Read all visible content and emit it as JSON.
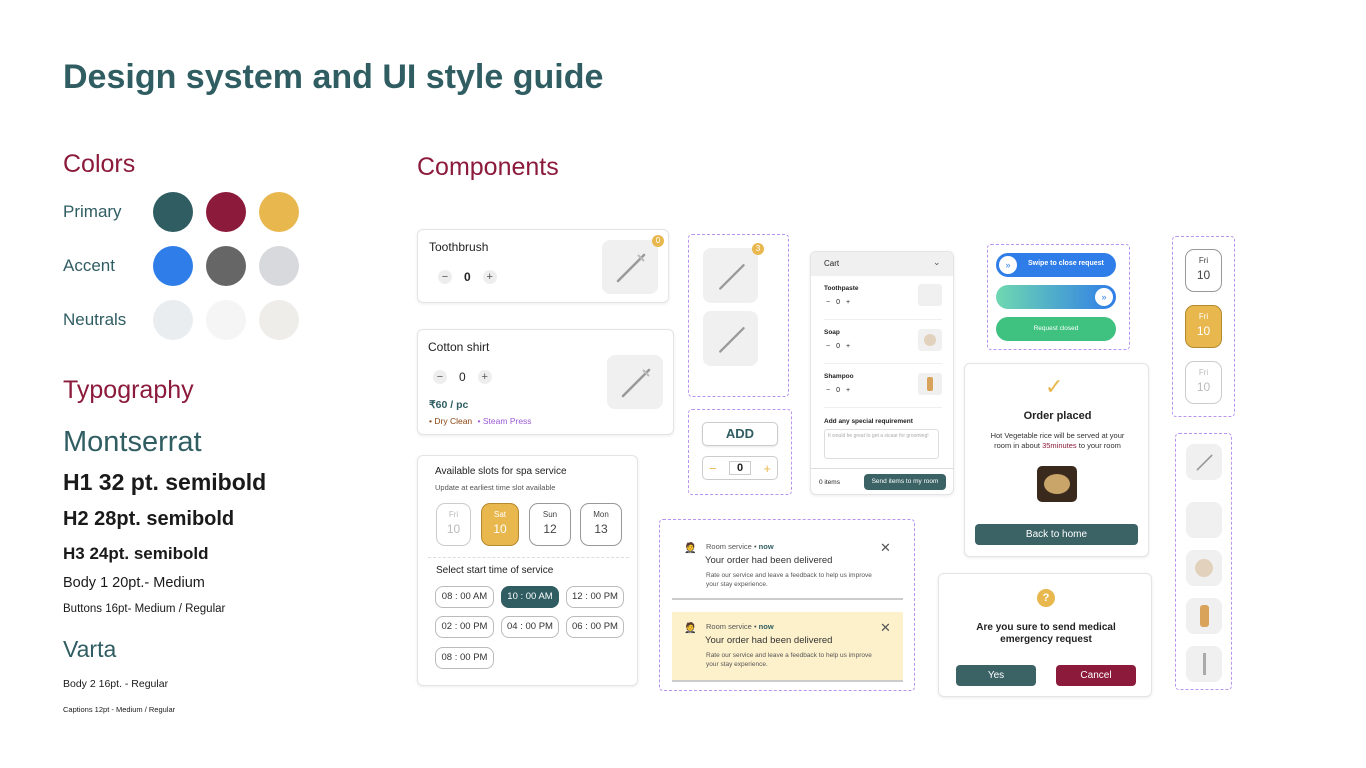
{
  "page": {
    "title": "Design system and UI style guide"
  },
  "colors": {
    "heading": "Colors",
    "rows": [
      {
        "label": "Primary",
        "swatches": [
          "#2f5d62",
          "#8b1a3b",
          "#e8b84f"
        ]
      },
      {
        "label": "Accent",
        "swatches": [
          "#2f7de8",
          "#666666",
          "#d8d9dc"
        ]
      },
      {
        "label": "Neutrals",
        "swatches": [
          "#e9edf0",
          "#f5f5f5",
          "#eeede9"
        ]
      }
    ]
  },
  "typography": {
    "heading": "Typography",
    "font1": "Montserrat",
    "h1": "H1 32 pt. semibold",
    "h2": "H2 28pt. semibold",
    "h3": "H3 24pt. semibold",
    "body1": "Body 1 20pt.- Medium",
    "buttons": "Buttons 16pt-  Medium / Regular",
    "font2": "Varta",
    "body2": "Body 2 16pt. - Regular",
    "captions": "Captions 12pt - Medium / Regular"
  },
  "components": {
    "heading": "Components",
    "toothbrush_card": {
      "name": "Toothbrush",
      "qty": "0",
      "badge": "0"
    },
    "shirt_card": {
      "name": "Cotton shirt",
      "qty": "0",
      "price": "₹60 / pc",
      "tag1": "Dry Clean",
      "tag2": "Steam Press"
    },
    "thumb_badge": "3",
    "add_widget": {
      "add_label": "ADD",
      "qty": "0"
    },
    "cart": {
      "title": "Cart",
      "items": [
        {
          "name": "Toothpaste",
          "qty": "0"
        },
        {
          "name": "Soap",
          "qty": "0"
        },
        {
          "name": "Shampoo",
          "qty": "0"
        }
      ],
      "special_label": "Add any special requirement",
      "special_placeholder": "It would be great to get a sicaar for grooming!",
      "items_count": "0 items",
      "send_label": "Send items to my room"
    },
    "swipe": {
      "swipe_label": "Swipe  to close request",
      "closed_label": "Request closed"
    },
    "days_column": [
      {
        "day": "Fri",
        "date": "10"
      },
      {
        "day": "Fri",
        "date": "10"
      },
      {
        "day": "Fri",
        "date": "10"
      }
    ],
    "order_placed": {
      "title": "Order placed",
      "line1": "Hot Vegetable rice will be served at your",
      "line2_pre": "room in about ",
      "line2_time": "35minutes",
      "line2_post": " to your room",
      "button": "Back to home"
    },
    "spa": {
      "title": "Available slots for spa service",
      "subtitle": "Update at earliest time slot available",
      "days": [
        {
          "day": "Fri",
          "date": "10"
        },
        {
          "day": "Sat",
          "date": "10"
        },
        {
          "day": "Sun",
          "date": "12"
        },
        {
          "day": "Mon",
          "date": "13"
        }
      ],
      "time_heading": "Select start time of service",
      "times": [
        "08 : 00 AM",
        "10 : 00 AM",
        "12 : 00 PM",
        "02 : 00 PM",
        "04 : 00 PM",
        "06 : 00 PM",
        "08 : 00 PM"
      ]
    },
    "notifications": [
      {
        "source": "Room service",
        "time": "now",
        "title": "Your order had been delivered",
        "body1": "Rate our service and leave a feedback to help us improve",
        "body2": "your stay experience."
      },
      {
        "source": "Room service",
        "time": "now",
        "title": "Your order had been delivered",
        "body1": "Rate our service and leave a feedback to help us improve",
        "body2": "your stay experience."
      }
    ],
    "confirm": {
      "line1": "Are you sure to send medical",
      "line2": "emergency request",
      "yes": "Yes",
      "cancel": "Cancel"
    }
  }
}
